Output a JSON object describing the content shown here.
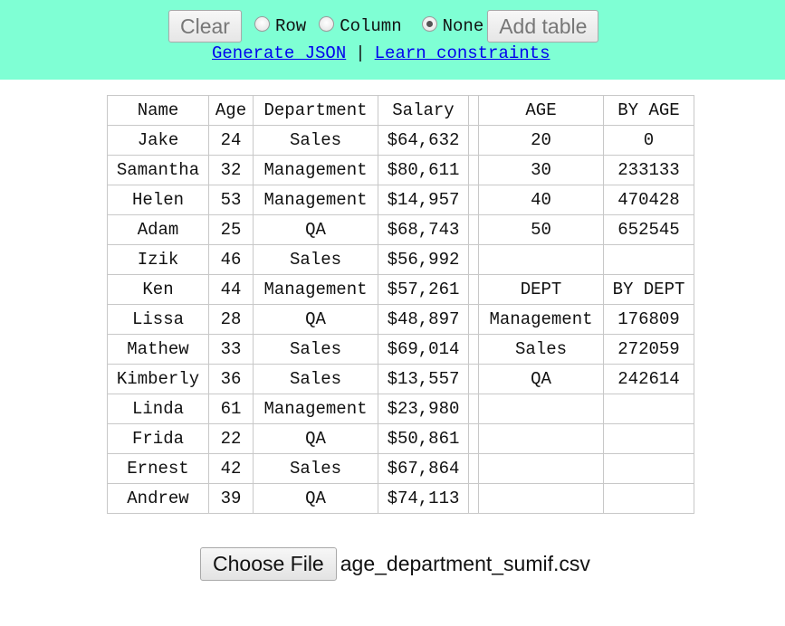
{
  "toolbar": {
    "clear_label": "Clear",
    "radios": [
      {
        "label": "Row",
        "checked": false
      },
      {
        "label": "Column",
        "checked": false
      },
      {
        "label": "None",
        "checked": true
      }
    ],
    "add_table_label": "Add table",
    "generate_json_link": "Generate JSON",
    "separator": "|",
    "learn_constraints_link": "Learn constraints",
    "background_color": "#7fffd4"
  },
  "table": {
    "header": {
      "name": "Name",
      "age": "Age",
      "department": "Department",
      "salary": "Salary",
      "summary_key": "AGE",
      "summary_val": "BY AGE"
    },
    "rows": [
      {
        "name": "Jake",
        "age": "24",
        "department": "Sales",
        "salary": "$64,632",
        "key": "20",
        "val": "0"
      },
      {
        "name": "Samantha",
        "age": "32",
        "department": "Management",
        "salary": "$80,611",
        "key": "30",
        "val": "233133"
      },
      {
        "name": "Helen",
        "age": "53",
        "department": "Management",
        "salary": "$14,957",
        "key": "40",
        "val": "470428"
      },
      {
        "name": "Adam",
        "age": "25",
        "department": "QA",
        "salary": "$68,743",
        "key": "50",
        "val": "652545"
      },
      {
        "name": "Izik",
        "age": "46",
        "department": "Sales",
        "salary": "$56,992",
        "key": "",
        "val": ""
      },
      {
        "name": "Ken",
        "age": "44",
        "department": "Management",
        "salary": "$57,261",
        "key": "DEPT",
        "val": "BY DEPT"
      },
      {
        "name": "Lissa",
        "age": "28",
        "department": "QA",
        "salary": "$48,897",
        "key": "Management",
        "val": "176809"
      },
      {
        "name": "Mathew",
        "age": "33",
        "department": "Sales",
        "salary": "$69,014",
        "key": "Sales",
        "val": "272059"
      },
      {
        "name": "Kimberly",
        "age": "36",
        "department": "Sales",
        "salary": "$13,557",
        "key": "QA",
        "val": "242614"
      },
      {
        "name": "Linda",
        "age": "61",
        "department": "Management",
        "salary": "$23,980",
        "key": "",
        "val": ""
      },
      {
        "name": "Frida",
        "age": "22",
        "department": "QA",
        "salary": "$50,861",
        "key": "",
        "val": ""
      },
      {
        "name": "Ernest",
        "age": "42",
        "department": "Sales",
        "salary": "$67,864",
        "key": "",
        "val": ""
      },
      {
        "name": "Andrew",
        "age": "39",
        "department": "QA",
        "salary": "$74,113",
        "key": "",
        "val": ""
      }
    ]
  },
  "file": {
    "choose_label": "Choose File",
    "filename": "age_department_sumif.csv"
  }
}
